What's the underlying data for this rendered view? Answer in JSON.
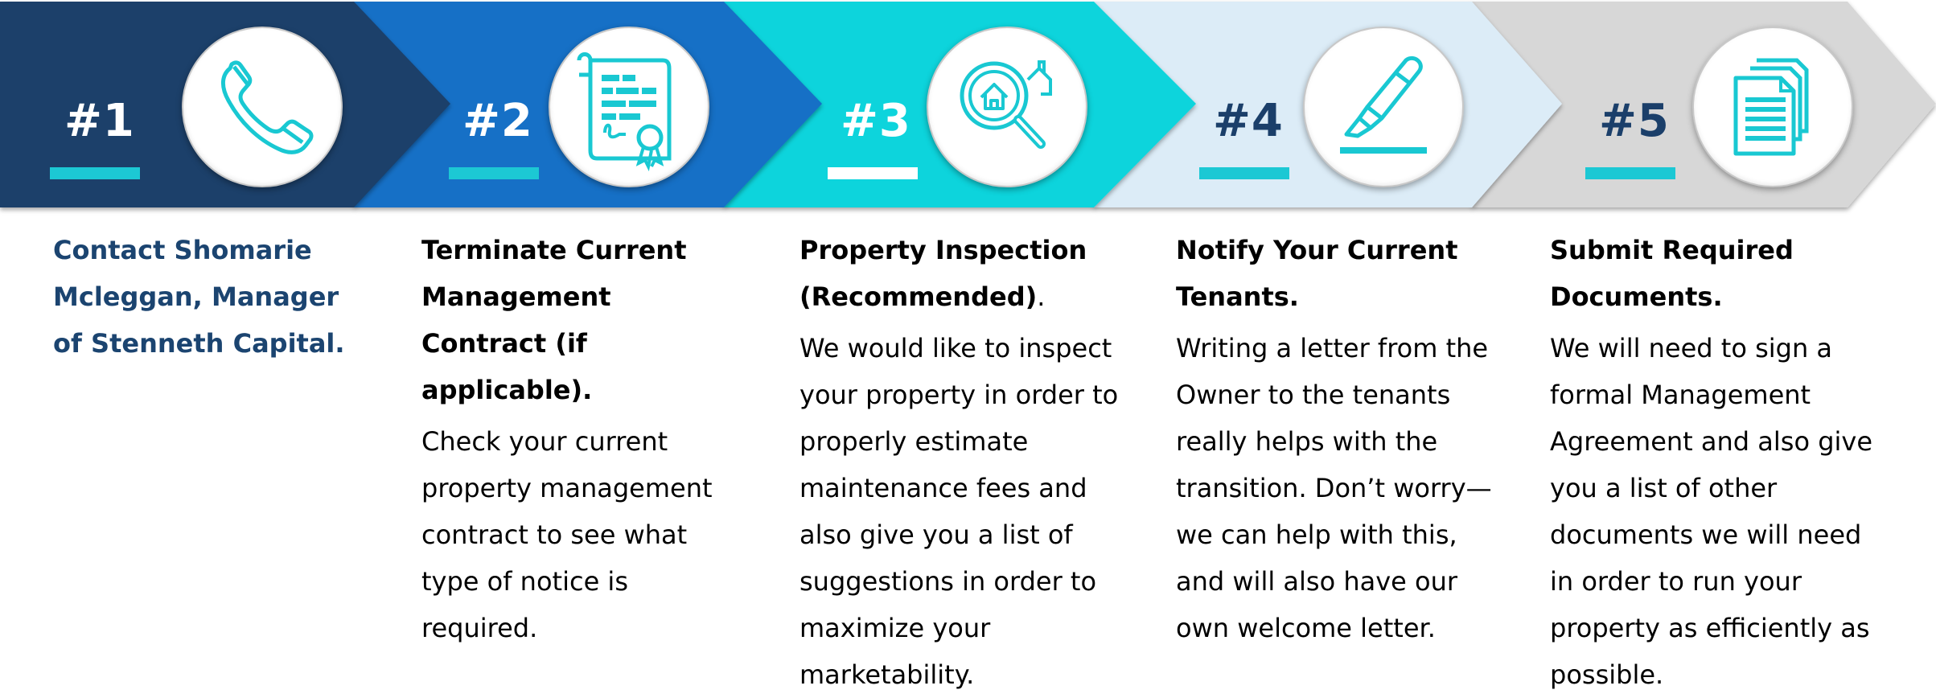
{
  "colors": {
    "step1": "#1b3f6a",
    "step2": "#136fc6",
    "step3": "#10d4dc",
    "step4": "#dcecf7",
    "step5": "#d7d7d7",
    "accent": "#1cc8d4",
    "icon": "#19c8d2",
    "title1": "#1b4470"
  },
  "steps": [
    {
      "number": "#1",
      "icon": "phone-icon",
      "title": "Contact Shomarie Mcleggan, Manager of Stenneth Capital.",
      "title_suffix": "",
      "body": ""
    },
    {
      "number": "#2",
      "icon": "contract-certificate-icon",
      "title": "Terminate Current Management Contract (if applicable).",
      "title_suffix": "",
      "body": "Check your current property management contract to see what type of notice is required."
    },
    {
      "number": "#3",
      "icon": "house-magnifier-icon",
      "title": "Property Inspection (Recommended)",
      "title_suffix": ".",
      "body": "We would like to inspect your property in order to properly estimate maintenance fees and also give you a list of suggestions in order to maximize your marketability."
    },
    {
      "number": "#4",
      "icon": "highlighter-pen-icon",
      "title": "Notify Your Current Tenants.",
      "title_suffix": "",
      "body": "Writing a letter from the Owner to the tenants really helps with the transition. Don’t worry—we can help with this,  and will also have our  own welcome letter."
    },
    {
      "number": "#5",
      "icon": "documents-stack-icon",
      "title": "Submit Required Documents.",
      "title_suffix": "",
      "body": "We will need to sign a formal Management Agreement and also give you a list of other documents we will need  in order to run your  property as efficiently as  possible."
    }
  ]
}
